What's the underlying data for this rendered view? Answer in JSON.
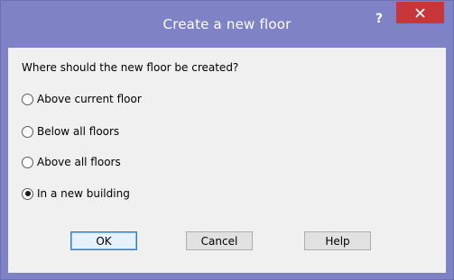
{
  "window": {
    "title": "Create a new floor",
    "help_glyph": "?",
    "close_glyph": "close-icon"
  },
  "dialog": {
    "prompt": "Where should the new floor be created?",
    "options": [
      {
        "label": "Above current floor",
        "selected": false
      },
      {
        "label": "Below all floors",
        "selected": false
      },
      {
        "label": "Above all floors",
        "selected": false
      },
      {
        "label": "In a new building",
        "selected": true
      }
    ],
    "buttons": {
      "ok": "OK",
      "cancel": "Cancel",
      "help": "Help"
    }
  },
  "colors": {
    "titlebar": "#7f83c5",
    "close_button": "#c7373a",
    "client_bg": "#f0f0f0",
    "default_button_border": "#3c7fb1"
  }
}
